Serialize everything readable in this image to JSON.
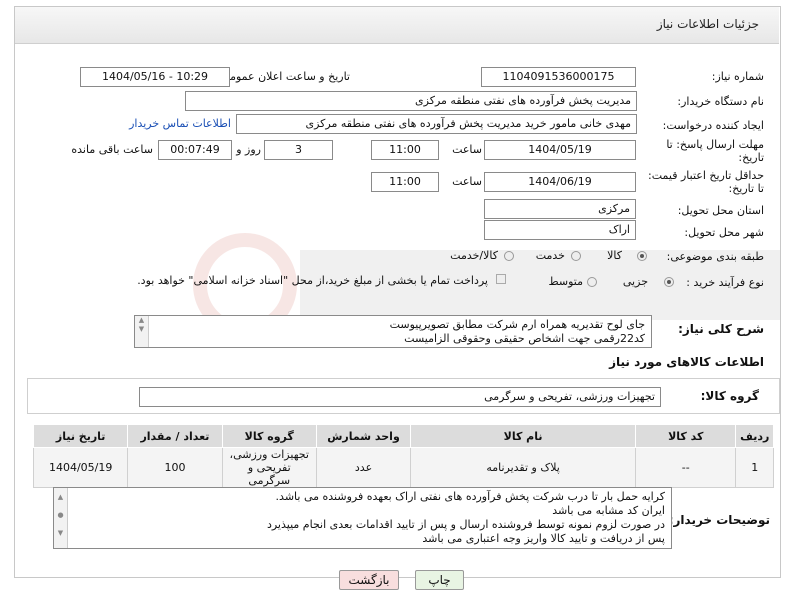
{
  "window": {
    "title": "جزئیات اطلاعات نیاز"
  },
  "fields": {
    "need_number_label": "شماره نیاز:",
    "need_number": "1104091536000175",
    "announce_label": "تاریخ و ساعت اعلان عمومی:",
    "announce_value": "1404/05/16 - 10:29",
    "buyer_label": "نام دستگاه خریدار:",
    "buyer_value": "مدیریت پخش فرآورده های نفتی منطقه مرکزی",
    "creator_label": "ایجاد کننده درخواست:",
    "creator_value": "مهدی خانی مامور خرید مدیریت پخش فرآورده های نفتی منطقه مرکزی",
    "contact_link": "اطلاعات تماس خریدار",
    "deadline_label_1": "مهلت ارسال پاسخ: تا",
    "deadline_label_2": "تاریخ:",
    "deadline_date": "1404/05/19",
    "time_label": "ساعت",
    "deadline_time": "11:00",
    "days_value": "3",
    "days_label": "روز و",
    "remaining_value": "00:07:49",
    "remaining_label": "ساعت باقی مانده",
    "validity_label_1": "حداقل تاریخ اعتبار قیمت:",
    "validity_label_2": "تا تاریخ:",
    "validity_date": "1404/06/19",
    "validity_time": "11:00",
    "province_label": "استان محل تحویل:",
    "province_value": "مرکزی",
    "city_label": "شهر محل تحویل:",
    "city_value": "اراک",
    "category_label": "طبقه بندی موضوعی:",
    "category_options": [
      "کالا",
      "خدمت",
      "کالا/خدمت"
    ],
    "process_label": "نوع فرآیند خرید :",
    "process_options": [
      "جزیی",
      "متوسط"
    ],
    "payment_note": "پرداخت تمام یا بخشی از مبلغ خرید،از محل \"اسناد خزانه اسلامی\" خواهد بود.",
    "description_label": "شرح کلی نیاز:",
    "description_lines": [
      "جای لوح تقدیریه همراه ارم شرکت مطابق تصویرپیوست",
      "کد22رقمی  جهت اشخاص حقیقی وحقوقی الزامیست"
    ],
    "goods_info_title": "اطلاعات کالاهای مورد نیاز",
    "goods_group_label": "گروه کالا:",
    "goods_group_value": "تجهیزات ورزشی، تفریحی و سرگرمی"
  },
  "table": {
    "headers": [
      "ردیف",
      "کد کالا",
      "نام کالا",
      "واحد شمارش",
      "گروه کالا",
      "تعداد / مقدار",
      "تاریخ نیاز"
    ],
    "rows": [
      [
        "1",
        "--",
        "پلاک و تقدیرنامه",
        "عدد",
        "تجهیزات ورزشی، تفریحی و سرگرمی",
        "100",
        "1404/05/19"
      ]
    ]
  },
  "buyer_notes": {
    "label": "توضیحات خریدار:",
    "lines": [
      "کرایه حمل بار تا درب شرکت  پخش فرآورده های نفتی اراک بعهده فروشنده می باشد.",
      "ایران کد مشابه می باشد",
      "در صورت لزوم نمونه توسط فروشنده ارسال و پس از تایید اقدامات بعدی انجام میپذیرد",
      "پس از دریافت و تایید کالا واریز وجه اعتباری می باشد"
    ]
  },
  "buttons": {
    "print": "چاپ",
    "back": "بازگشت"
  },
  "colors": {
    "link": "#1a4fb5",
    "print_button": "#e8f4e3",
    "back_button": "#f8dede"
  }
}
